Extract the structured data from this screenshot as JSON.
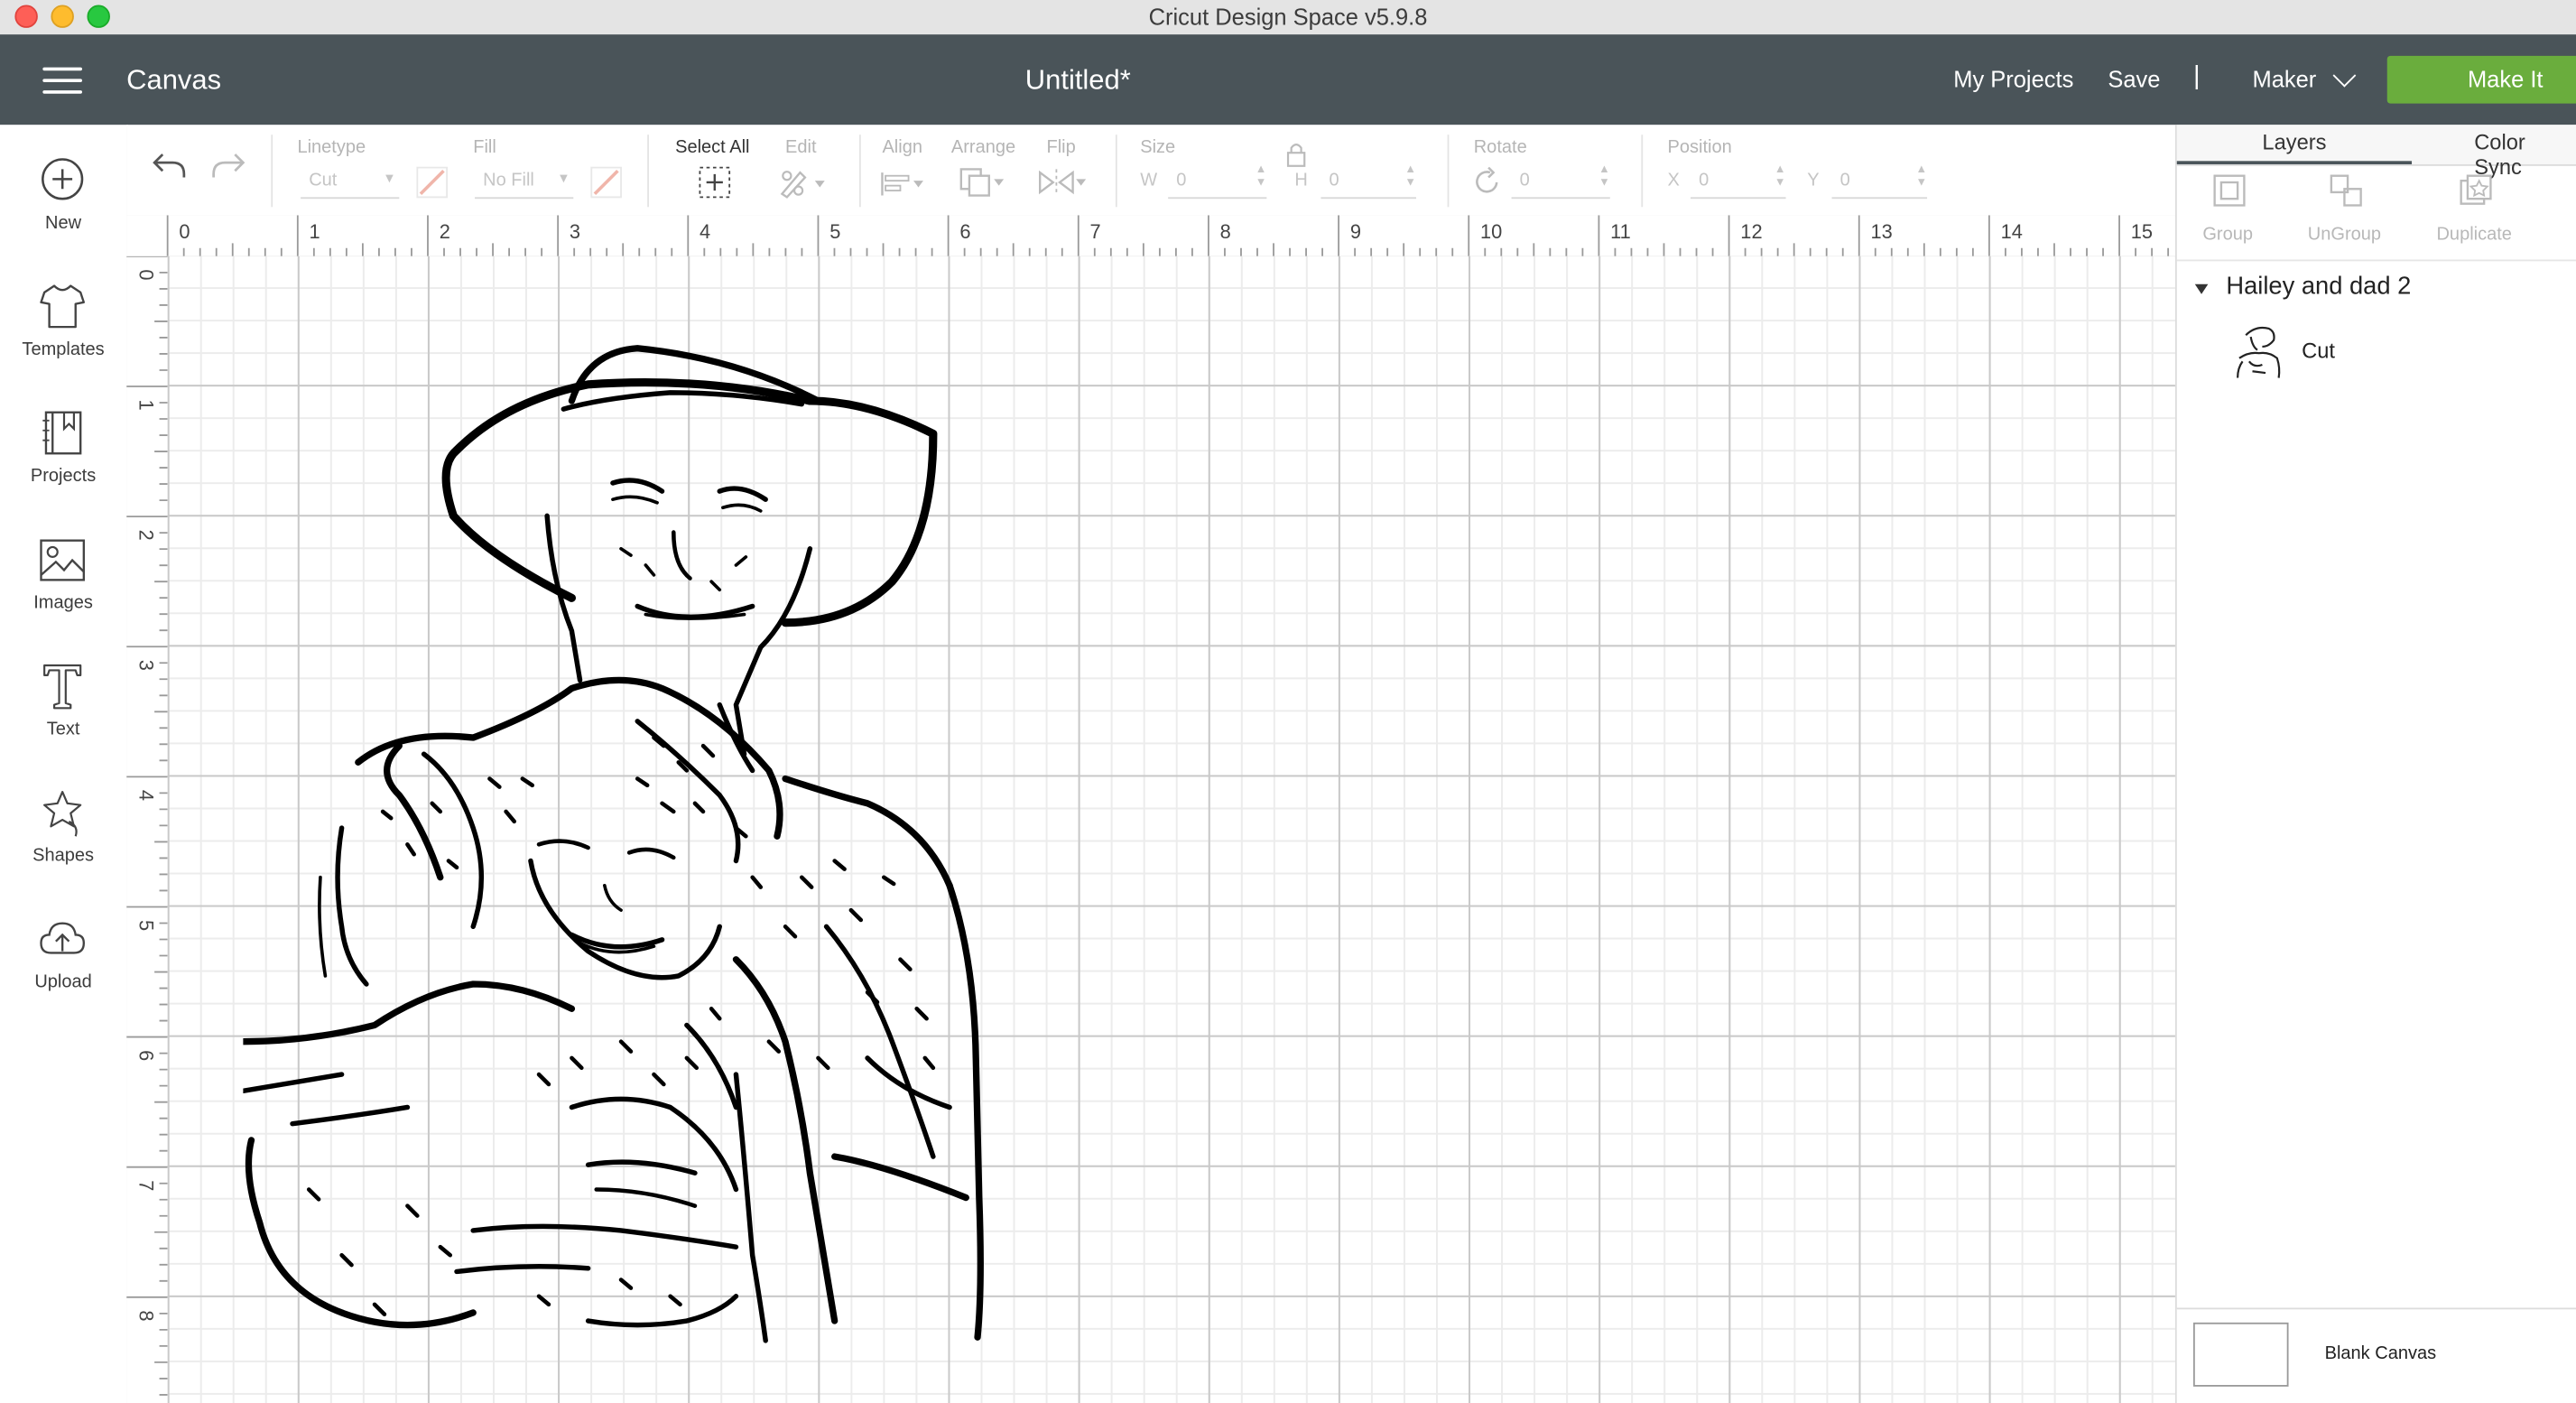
{
  "window": {
    "title": "Cricut Design Space  v5.9.8"
  },
  "header": {
    "section": "Canvas",
    "document_title": "Untitled*",
    "my_projects": "My Projects",
    "save": "Save",
    "separator": "|",
    "machine": "Maker",
    "make_it": "Make It"
  },
  "sidebar": {
    "items": [
      {
        "label": "New",
        "icon": "plus-circle-icon"
      },
      {
        "label": "Templates",
        "icon": "tshirt-icon"
      },
      {
        "label": "Projects",
        "icon": "projects-book-icon"
      },
      {
        "label": "Images",
        "icon": "image-icon"
      },
      {
        "label": "Text",
        "icon": "text-t-icon"
      },
      {
        "label": "Shapes",
        "icon": "shapes-icon"
      },
      {
        "label": "Upload",
        "icon": "cloud-upload-icon"
      }
    ]
  },
  "toolbar": {
    "linetype_label": "Linetype",
    "linetype_value": "Cut",
    "fill_label": "Fill",
    "fill_value": "No Fill",
    "select_all_label": "Select All",
    "edit_label": "Edit",
    "align_label": "Align",
    "arrange_label": "Arrange",
    "flip_label": "Flip",
    "size_label": "Size",
    "size_w_label": "W",
    "size_w_value": "0",
    "size_h_label": "H",
    "size_h_value": "0",
    "rotate_label": "Rotate",
    "rotate_value": "0",
    "position_label": "Position",
    "position_x_label": "X",
    "position_x_value": "0",
    "position_y_label": "Y",
    "position_y_value": "0"
  },
  "rulers": {
    "top": [
      "0",
      "1",
      "2",
      "3",
      "4",
      "5",
      "6",
      "7",
      "8",
      "9",
      "10",
      "11",
      "12",
      "13",
      "14",
      "15"
    ],
    "left": [
      "0",
      "1",
      "2",
      "3",
      "4",
      "5",
      "6",
      "7",
      "8"
    ]
  },
  "panel": {
    "tabs": [
      "Layers",
      "Color Sync"
    ],
    "active_tab": "Layers",
    "actions": [
      "Group",
      "UnGroup",
      "Duplicate"
    ],
    "layer_group_name": "Hailey and dad 2",
    "layer_item_label": "Cut",
    "blank_canvas_label": "Blank Canvas"
  }
}
